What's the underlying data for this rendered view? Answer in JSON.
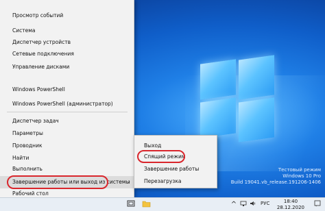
{
  "menu": {
    "items": [
      {
        "label": "Просмотр событий"
      },
      {
        "label": "Система"
      },
      {
        "label": "Диспетчер устройств"
      },
      {
        "label": "Сетевые подключения"
      },
      {
        "label": "Управление дисками"
      },
      {
        "label": "Windows PowerShell"
      },
      {
        "label": "Windows PowerShell (администратор)"
      },
      {
        "label": "Диспетчер задач"
      },
      {
        "label": "Параметры"
      },
      {
        "label": "Проводник"
      },
      {
        "label": "Найти"
      },
      {
        "label": "Выполнить"
      },
      {
        "label": "Завершение работы или выход из системы",
        "arrow": "›"
      },
      {
        "label": "Рабочий стол"
      }
    ]
  },
  "submenu": {
    "items": [
      {
        "label": "Выход"
      },
      {
        "label": "Спящий режим"
      },
      {
        "label": "Завершение работы"
      },
      {
        "label": "Перезагрузка"
      }
    ]
  },
  "watermark": {
    "line1": "Тестовый режим",
    "line2": "Windows 10 Pro",
    "line3": "Build 19041.vb_release.191206-1406"
  },
  "taskbar": {
    "lang": "РУС",
    "time": "18:40",
    "date": "28.12.2020",
    "icons": [
      "task-view-icon",
      "file-explorer-icon",
      "chevron-up-icon",
      "network-icon",
      "volume-icon",
      "notifications-icon"
    ]
  },
  "colors": {
    "highlight_ring": "#d9262c",
    "menu_bg": "#f2f2f2",
    "desktop": "#1f7fe6"
  }
}
